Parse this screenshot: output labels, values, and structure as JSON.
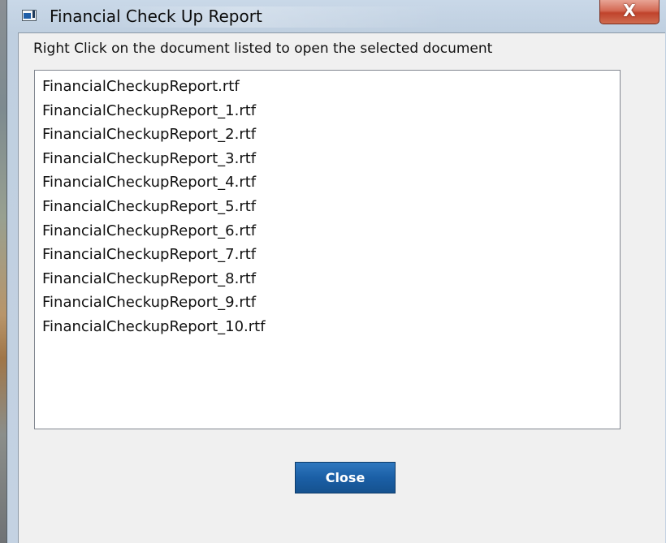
{
  "window": {
    "title": "Financial Check Up Report",
    "close_glyph": "X"
  },
  "instruction": "Right Click on the document listed to open the selected document",
  "documents": [
    "FinancialCheckupReport.rtf",
    "FinancialCheckupReport_1.rtf",
    "FinancialCheckupReport_2.rtf",
    "FinancialCheckupReport_3.rtf",
    "FinancialCheckupReport_4.rtf",
    "FinancialCheckupReport_5.rtf",
    "FinancialCheckupReport_6.rtf",
    "FinancialCheckupReport_7.rtf",
    "FinancialCheckupReport_8.rtf",
    "FinancialCheckupReport_9.rtf",
    "FinancialCheckupReport_10.rtf"
  ],
  "buttons": {
    "close_label": "Close"
  },
  "icons": {
    "app": "app-window-icon",
    "close": "close-icon"
  },
  "colors": {
    "button_blue": "#1b5fa6",
    "close_red": "#c0432c"
  }
}
